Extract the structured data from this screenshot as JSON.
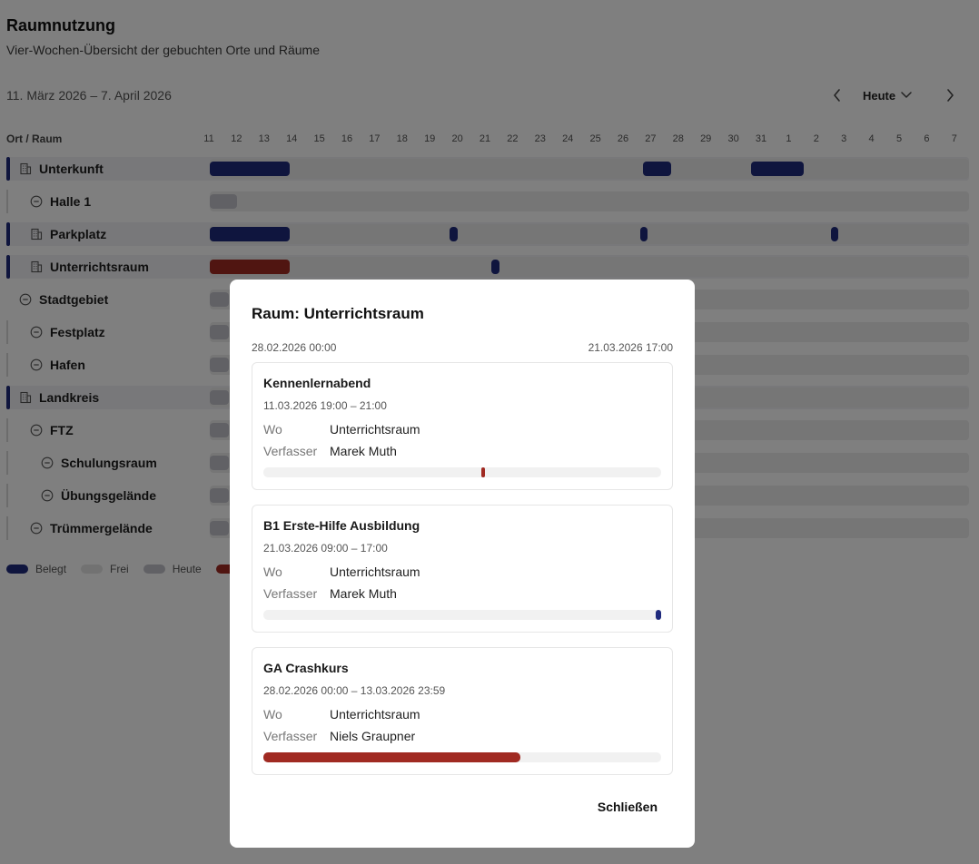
{
  "page": {
    "title": "Raumnutzung",
    "subtitle": "Vier-Wochen-Übersicht der gebuchten Orte und Räume",
    "range": "11. März 2026 – 7. April 2026",
    "today_label": "Heute"
  },
  "icons": {
    "prev": "chevron-left-icon",
    "next": "chevron-right-icon",
    "dropdown": "chevron-down-icon",
    "building": "building-icon",
    "collapse": "minus-circle-icon"
  },
  "grid": {
    "column_header": "Ort / Raum",
    "days": [
      "11",
      "12",
      "13",
      "14",
      "15",
      "16",
      "17",
      "18",
      "19",
      "20",
      "21",
      "22",
      "23",
      "24",
      "25",
      "26",
      "27",
      "28",
      "29",
      "30",
      "31",
      "1",
      "2",
      "3",
      "4",
      "5",
      "6",
      "7"
    ],
    "rows": [
      {
        "label": "Unterkunft",
        "icon": "building-icon",
        "level": 0,
        "kind": "band"
      },
      {
        "label": "Halle 1",
        "icon": "minus-circle-icon",
        "level": 1,
        "kind": "plain"
      },
      {
        "label": "Parkplatz",
        "icon": "building-icon",
        "level": 1,
        "kind": "band"
      },
      {
        "label": "Unterrichtsraum",
        "icon": "building-icon",
        "level": 1,
        "kind": "band"
      },
      {
        "label": "Stadtgebiet",
        "icon": "minus-circle-icon",
        "level": 0,
        "kind": "plain"
      },
      {
        "label": "Festplatz",
        "icon": "minus-circle-icon",
        "level": 1,
        "kind": "plain"
      },
      {
        "label": "Hafen",
        "icon": "minus-circle-icon",
        "level": 1,
        "kind": "plain"
      },
      {
        "label": "Landkreis",
        "icon": "building-icon",
        "level": 0,
        "kind": "band"
      },
      {
        "label": "FTZ",
        "icon": "minus-circle-icon",
        "level": 1,
        "kind": "plain"
      },
      {
        "label": "Schulungsraum",
        "icon": "minus-circle-icon",
        "level": 2,
        "kind": "plain"
      },
      {
        "label": "Übungsgelände",
        "icon": "minus-circle-icon",
        "level": 2,
        "kind": "plain"
      },
      {
        "label": "Trümmergelände",
        "icon": "minus-circle-icon",
        "level": 1,
        "kind": "plain"
      }
    ]
  },
  "legend": [
    {
      "label": "Belegt",
      "color": "#1f2a7d"
    },
    {
      "label": "Frei",
      "color": "#e4e4e4"
    },
    {
      "label": "Heute",
      "color": "#c3c3cb"
    }
  ],
  "colors": {
    "booked": "#1f2a7d",
    "own": "#a02a22",
    "free": "#ececec",
    "today": "#c3c3cb"
  },
  "modal": {
    "title": "Raum: Unterrichtsraum",
    "span_start": "28.02.2026 00:00",
    "span_end": "21.03.2026 17:00",
    "where_label": "Wo",
    "author_label": "Verfasser",
    "close_label": "Schließen",
    "events": [
      {
        "title": "Kennenlernabend",
        "time": "11.03.2026 19:00 – 21:00",
        "where": "Unterrichtsraum",
        "author": "Marek Muth",
        "span_fraction": [
          0.547,
          0.556
        ],
        "color": "#a02a22"
      },
      {
        "title": "B1 Erste-Hilfe Ausbildung",
        "time": "21.03.2026 09:00 – 17:00",
        "where": "Unterrichtsraum",
        "author": "Marek Muth",
        "span_fraction": [
          0.986,
          1.0
        ],
        "color": "#1f2a7d"
      },
      {
        "title": "GA Crashkurs",
        "time": "28.02.2026 00:00 – 13.03.2026 23:59",
        "where": "Unterrichtsraum",
        "author": "Niels Graupner",
        "span_fraction": [
          0.0,
          0.645
        ],
        "color": "#a02a22"
      }
    ]
  }
}
